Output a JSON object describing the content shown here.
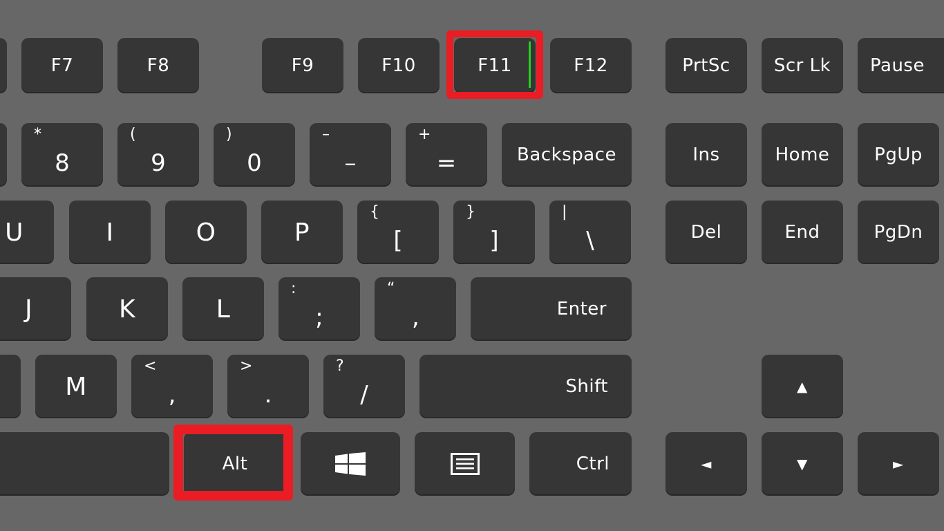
{
  "function_row": [
    "F7",
    "F8",
    "F9",
    "F10",
    "F11",
    "F12"
  ],
  "system_keys": [
    "PrtSc",
    "Scr Lk",
    "Pause"
  ],
  "number_row": [
    {
      "upper": "*",
      "lower": "8"
    },
    {
      "upper": "(",
      "lower": "9"
    },
    {
      "upper": ")",
      "lower": "0"
    },
    {
      "upper": "–",
      "lower": "–"
    },
    {
      "upper": "+",
      "lower": "="
    }
  ],
  "backspace": "Backspace",
  "nav_top": [
    "Ins",
    "Home",
    "PgUp"
  ],
  "nav_bottom": [
    "Del",
    "End",
    "PgDn"
  ],
  "row_u": [
    "U",
    "I",
    "O",
    "P"
  ],
  "brackets": [
    {
      "upper": "{",
      "lower": "["
    },
    {
      "upper": "}",
      "lower": "]"
    },
    {
      "upper": "|",
      "lower": "\\"
    }
  ],
  "row_j": [
    "J",
    "K",
    "L"
  ],
  "punct_j": [
    {
      "upper": ":",
      "lower": ";"
    },
    {
      "upper": "“",
      "lower": "‚"
    }
  ],
  "enter": "Enter",
  "row_m": [
    "M"
  ],
  "punct_m": [
    {
      "upper": "<",
      "lower": ","
    },
    {
      "upper": ">",
      "lower": "."
    },
    {
      "upper": "?",
      "lower": "/"
    }
  ],
  "shift": "Shift",
  "alt": "Alt",
  "ctrl": "Ctrl",
  "arrows": {
    "up": "▲",
    "left": "◄",
    "down": "▼",
    "right": "►"
  },
  "highlight_color": "#ea1c24",
  "icons": [
    "windows-icon",
    "menu-icon"
  ]
}
